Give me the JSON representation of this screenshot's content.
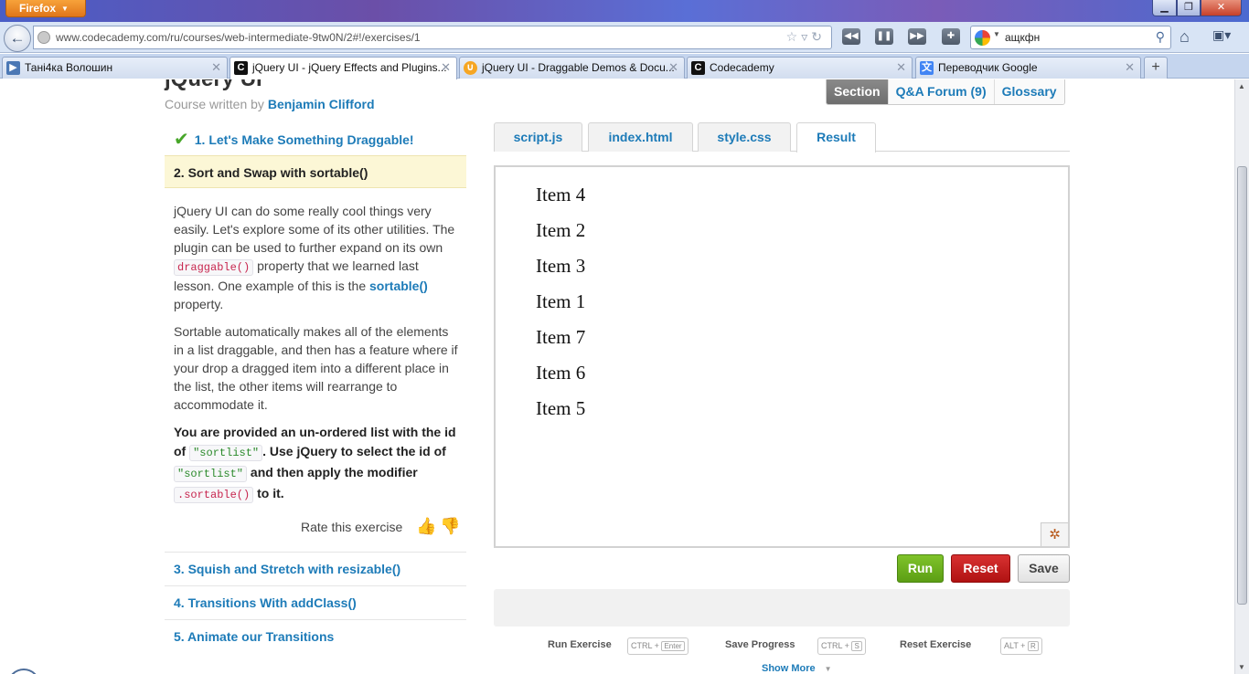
{
  "browser": {
    "menu_label": "Firefox",
    "url": "www.codecademy.com/ru/courses/web-intermediate-9tw0N/2#!/exercises/1",
    "search_text": "ащкфн",
    "tabs": [
      {
        "label": "Тані4ка Волошин"
      },
      {
        "label": "jQuery UI - jQuery Effects and Plugins..."
      },
      {
        "label": "jQuery UI - Draggable Demos & Docu..."
      },
      {
        "label": "Codecademy"
      },
      {
        "label": "Переводчик Google"
      }
    ]
  },
  "course": {
    "title": "jQuery UI",
    "author_prefix": "Course written by",
    "author": "Benjamin Clifford"
  },
  "top_tabs": {
    "section": "Section",
    "forum": "Q&A Forum (9)",
    "glossary": "Glossary"
  },
  "lessons": {
    "l1": "1. Let's Make Something Draggable!",
    "l2": "2. Sort and Swap with sortable()",
    "l3": "3. Squish and Stretch with resizable()",
    "l4": "4. Transitions With addClass()",
    "l5": "5. Animate our Transitions"
  },
  "instructions": {
    "p1_a": "jQuery UI can do some really cool things very easily. Let's explore some of its other utilities. The plugin can be used to further expand on its own ",
    "p1_code": "draggable()",
    "p1_b": " property that we learned last lesson. One example of this is the ",
    "p1_link": "sortable()",
    "p1_c": " property.",
    "p2": "Sortable automatically makes all of the elements in a list draggable, and then has a feature where if your drop a dragged item into a different place in the list, the other items will rearrange to accommodate it.",
    "task_a": "You are provided an un-ordered list with the id of ",
    "task_code1": "\"sortlist\"",
    "task_b": ". Use jQuery to select the id of ",
    "task_code2": "\"sortlist\"",
    "task_c": " and then apply the modifier ",
    "task_code3": ".sortable()",
    "task_d": " to it."
  },
  "rate_label": "Rate this exercise",
  "file_tabs": {
    "script": "script.js",
    "index": "index.html",
    "style": "style.css",
    "result": "Result"
  },
  "result_items": [
    "Item 4",
    "Item 2",
    "Item 3",
    "Item 1",
    "Item 7",
    "Item 6",
    "Item 5"
  ],
  "buttons": {
    "run": "Run",
    "reset": "Reset",
    "save": "Save"
  },
  "shortcuts": {
    "run_label": "Run Exercise",
    "run_key": "CTRL +",
    "run_key2": "Enter",
    "save_label": "Save Progress",
    "save_key": "CTRL +",
    "save_key2": "S",
    "reset_label": "Reset Exercise",
    "reset_key": "ALT +",
    "reset_key2": "R"
  },
  "show_more": "Show More"
}
